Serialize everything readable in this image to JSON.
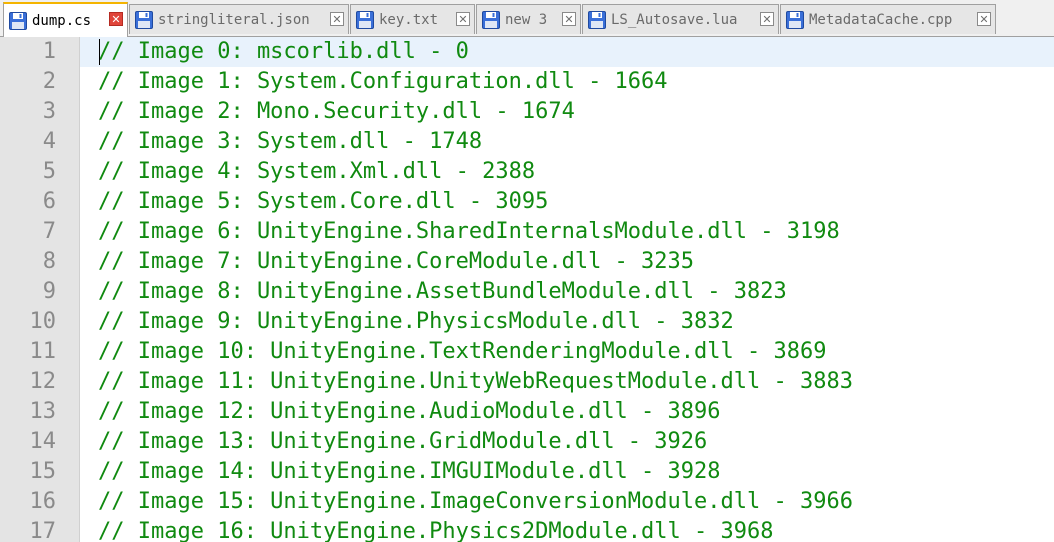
{
  "tabs": [
    {
      "label": "dump.cs",
      "active": true,
      "icon": "floppy-disk-icon"
    },
    {
      "label": "stringliteral.json",
      "active": false,
      "icon": "floppy-disk-icon"
    },
    {
      "label": "key.txt",
      "active": false,
      "icon": "floppy-disk-icon"
    },
    {
      "label": "new 3",
      "active": false,
      "icon": "floppy-disk-icon"
    },
    {
      "label": "LS_Autosave.lua",
      "active": false,
      "icon": "floppy-disk-icon"
    },
    {
      "label": "MetadataCache.cpp",
      "active": false,
      "icon": "floppy-disk-icon"
    }
  ],
  "tab_close_glyph": "✕",
  "colors": {
    "comment_text": "#108a10",
    "line_number": "#8a8a8a",
    "current_line_bg": "#e8f2fc",
    "gutter_bg": "#e4e4e4",
    "active_tab_accent": "#f4b400",
    "close_button_active": "#e0453a",
    "saved_icon": "#3a6fd8",
    "unsaved_icon": "#d23030"
  },
  "editor": {
    "lines": [
      {
        "number": "1",
        "text": "// Image 0: mscorlib.dll - 0"
      },
      {
        "number": "2",
        "text": "// Image 1: System.Configuration.dll - 1664"
      },
      {
        "number": "3",
        "text": "// Image 2: Mono.Security.dll - 1674"
      },
      {
        "number": "4",
        "text": "// Image 3: System.dll - 1748"
      },
      {
        "number": "5",
        "text": "// Image 4: System.Xml.dll - 2388"
      },
      {
        "number": "6",
        "text": "// Image 5: System.Core.dll - 3095"
      },
      {
        "number": "7",
        "text": "// Image 6: UnityEngine.SharedInternalsModule.dll - 3198"
      },
      {
        "number": "8",
        "text": "// Image 7: UnityEngine.CoreModule.dll - 3235"
      },
      {
        "number": "9",
        "text": "// Image 8: UnityEngine.AssetBundleModule.dll - 3823"
      },
      {
        "number": "10",
        "text": "// Image 9: UnityEngine.PhysicsModule.dll - 3832"
      },
      {
        "number": "11",
        "text": "// Image 10: UnityEngine.TextRenderingModule.dll - 3869"
      },
      {
        "number": "12",
        "text": "// Image 11: UnityEngine.UnityWebRequestModule.dll - 3883"
      },
      {
        "number": "13",
        "text": "// Image 12: UnityEngine.AudioModule.dll - 3896"
      },
      {
        "number": "14",
        "text": "// Image 13: UnityEngine.GridModule.dll - 3926"
      },
      {
        "number": "15",
        "text": "// Image 14: UnityEngine.IMGUIModule.dll - 3928"
      },
      {
        "number": "16",
        "text": "// Image 15: UnityEngine.ImageConversionModule.dll - 3966"
      },
      {
        "number": "17",
        "text": "// Image 16: UnityEngine.Physics2DModule.dll - 3968"
      }
    ]
  }
}
